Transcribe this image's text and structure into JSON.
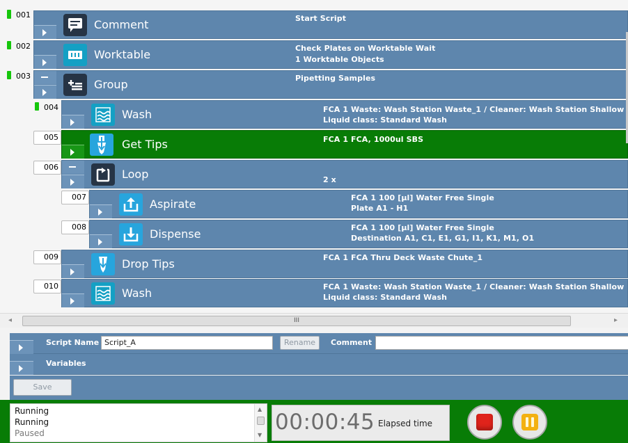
{
  "script": {
    "rows": [
      {
        "num": "001",
        "label": "Comment",
        "icon": "comment-icon",
        "details": [
          "Start Script"
        ]
      },
      {
        "num": "002",
        "label": "Worktable",
        "icon": "worktable-icon",
        "details": [
          "Check Plates on Worktable Wait",
          "1 Worktable Objects"
        ]
      },
      {
        "num": "003",
        "label": "Group",
        "icon": "group-icon",
        "details": [
          "Pipetting Samples"
        ]
      },
      {
        "num": "004",
        "label": "Wash",
        "icon": "wash-icon",
        "details": [
          "FCA 1   Waste: Wash Station Waste_1 / Cleaner: Wash Station Shallow",
          "Liquid class: Standard Wash"
        ]
      },
      {
        "num": "005",
        "label": "Get Tips",
        "icon": "get-tips-icon",
        "details": [
          "FCA 1   FCA, 1000ul SBS"
        ]
      },
      {
        "num": "006",
        "label": "Loop",
        "icon": "loop-icon",
        "details": [
          "2 x"
        ]
      },
      {
        "num": "007",
        "label": "Aspirate",
        "icon": "aspirate-icon",
        "details": [
          "FCA 1   100 [µl]   Water Free Single",
          "Plate   A1 - H1"
        ]
      },
      {
        "num": "008",
        "label": "Dispense",
        "icon": "dispense-icon",
        "details": [
          "FCA 1   100 [µl]   Water Free Single",
          "Destination   A1, C1, E1, G1, I1, K1, M1, O1"
        ]
      },
      {
        "num": "009",
        "label": "Drop Tips",
        "icon": "drop-tips-icon",
        "details": [
          "FCA 1   FCA Thru Deck Waste Chute_1"
        ]
      },
      {
        "num": "010",
        "label": "Wash",
        "icon": "wash-icon",
        "details": [
          "FCA 1   Waste: Wash Station Waste_1 / Cleaner: Wash Station Shallow",
          "Liquid class: Standard Wash"
        ]
      }
    ],
    "selected_row": "005"
  },
  "hscroll": {
    "grip": "III"
  },
  "properties": {
    "script_name_label": "Script Name",
    "script_name_value": "Script_A",
    "rename_label": "Rename",
    "comment_label": "Comment",
    "comment_value": "",
    "variables_label": "Variables",
    "save_label": "Save"
  },
  "status": {
    "lines": [
      "Running",
      "Running",
      "Paused"
    ],
    "timer": "00:00:45",
    "elapsed_label": "Elapsed time"
  },
  "colors": {
    "row_blue": "#5e86ad",
    "selected_green": "#087c06",
    "marker_green": "#16c60c",
    "stop_red": "#e0231b",
    "pause_orange": "#f3b111"
  }
}
